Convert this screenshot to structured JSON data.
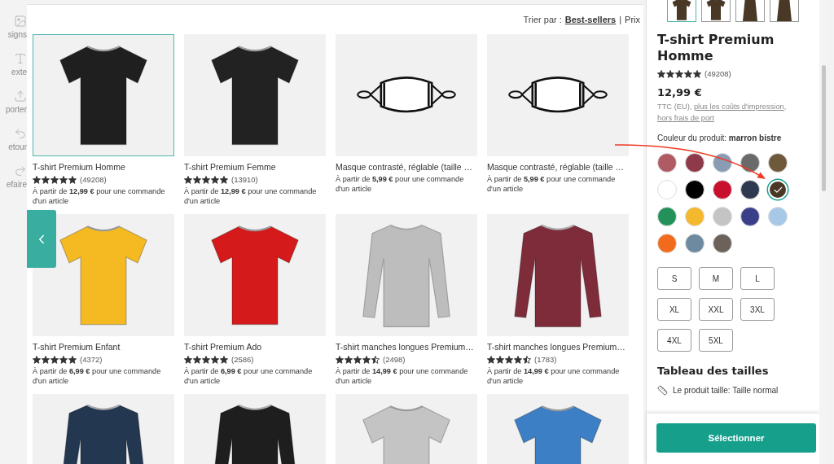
{
  "sidebar": {
    "items": [
      {
        "kind": "image",
        "label": "signs"
      },
      {
        "kind": "text",
        "label": "exte"
      },
      {
        "kind": "upload",
        "label": "porter"
      },
      {
        "kind": "undo",
        "label": "etour"
      },
      {
        "kind": "redo",
        "label": "efaire"
      }
    ]
  },
  "sort": {
    "label": "Trier par :",
    "separator": "|",
    "options": [
      {
        "label": "Best-sellers",
        "selected": true
      },
      {
        "label": "Prix",
        "selected": false
      }
    ]
  },
  "products": [
    {
      "kind": "tshirt",
      "color": "#1f1f1f",
      "selected": true,
      "title": "T-shirt Premium Homme",
      "stars": 5,
      "reviews": "(49208)",
      "price": "À partir de **12,99 €** pour une commande d'un article"
    },
    {
      "kind": "tshirt",
      "color": "#222222",
      "selected": false,
      "title": "T-shirt Premium Femme",
      "stars": 5,
      "reviews": "(13910)",
      "price": "À partir de **12,99 €** pour une commande d'un article"
    },
    {
      "kind": "mask",
      "color": "#ffffff",
      "selected": false,
      "title": "Masque contrasté, réglable (taille …",
      "price": "À partir de **5,99 €** pour une commande d'un article"
    },
    {
      "kind": "mask",
      "color": "#ffffff",
      "selected": false,
      "title": "Masque contrasté, réglable (taille …",
      "price": "À partir de **5,99 €** pour une commande d'un article"
    },
    {
      "kind": "tshirt",
      "color": "#f5b921",
      "selected": false,
      "title": "T-shirt Premium Enfant",
      "stars": 5,
      "reviews": "(4372)",
      "price": "À partir de **6,99 €** pour une commande d'un article"
    },
    {
      "kind": "tshirt",
      "color": "#d41a1a",
      "selected": false,
      "title": "T-shirt Premium Ado",
      "stars": 5,
      "reviews": "(2586)",
      "price": "À partir de **6,99 €** pour une commande d'un article"
    },
    {
      "kind": "longsleeve",
      "color": "#bdbdbd",
      "selected": false,
      "title": "T-shirt manches longues Premium…",
      "stars": 4.5,
      "reviews": "(2498)",
      "price": "À partir de **14,99 €** pour une commande d'un article"
    },
    {
      "kind": "longsleeve",
      "color": "#7e2c3a",
      "selected": false,
      "title": "T-shirt manches longues Premium…",
      "stars": 4.5,
      "reviews": "(1783)",
      "price": "À partir de **14,99 €** pour une commande d'un article"
    },
    {
      "kind": "longsleeve",
      "color": "#243750",
      "selected": false
    },
    {
      "kind": "longsleeve",
      "color": "#1e1e1e",
      "selected": false
    },
    {
      "kind": "tshirt",
      "color": "#c4c4c4",
      "selected": false
    },
    {
      "kind": "tshirt",
      "color": "#3d7fc4",
      "selected": false
    }
  ],
  "detail": {
    "thumbnails": [
      {
        "kind": "tshirt",
        "selected": true
      },
      {
        "kind": "tshirt",
        "selected": false
      },
      {
        "kind": "sleeve",
        "selected": false
      },
      {
        "kind": "sleeve",
        "selected": false
      }
    ],
    "title": "T-shirt Premium Homme",
    "stars": 5,
    "reviews": "(49208)",
    "price": "12,99 €",
    "tax_note": [
      {
        "kind": "text",
        "text": "TTC (EU), "
      },
      {
        "kind": "link",
        "text": "plus les coûts d'impression"
      },
      {
        "kind": "text",
        "text": ", "
      },
      {
        "kind": "link",
        "text": "hors frais de port"
      }
    ],
    "color_label": "Couleur du produit: **marron bistre**",
    "swatches": [
      {
        "color": "#b05a64",
        "selected": false
      },
      {
        "color": "#8e3a4a",
        "selected": false
      },
      {
        "color": "#8a9bb4",
        "selected": false
      },
      {
        "color": "#6a6a6a",
        "selected": false
      },
      {
        "color": "#6e5a3a",
        "selected": false
      },
      {
        "color": "#ffffff",
        "selected": false
      },
      {
        "color": "#000000",
        "selected": false
      },
      {
        "color": "#c8102e",
        "selected": false
      },
      {
        "color": "#2e3a50",
        "selected": false
      },
      {
        "color": "#4a3826",
        "selected": true
      },
      {
        "color": "#23915a",
        "selected": false
      },
      {
        "color": "#f4b82e",
        "selected": false
      },
      {
        "color": "#c4c4c4",
        "selected": false
      },
      {
        "color": "#3a3f8a",
        "selected": false
      },
      {
        "color": "#a8c8e8",
        "selected": false
      },
      {
        "color": "#f26a1b",
        "selected": false
      },
      {
        "color": "#6e8aa0",
        "selected": false
      },
      {
        "color": "#6b625a",
        "selected": false
      }
    ],
    "sizes": [
      "S",
      "M",
      "L",
      "XL",
      "XXL",
      "3XL",
      "4XL",
      "5XL"
    ],
    "size_chart_title": "Tableau des tailles",
    "fit": "Le produit taille: Taille normal",
    "button": "Sélectionner"
  }
}
